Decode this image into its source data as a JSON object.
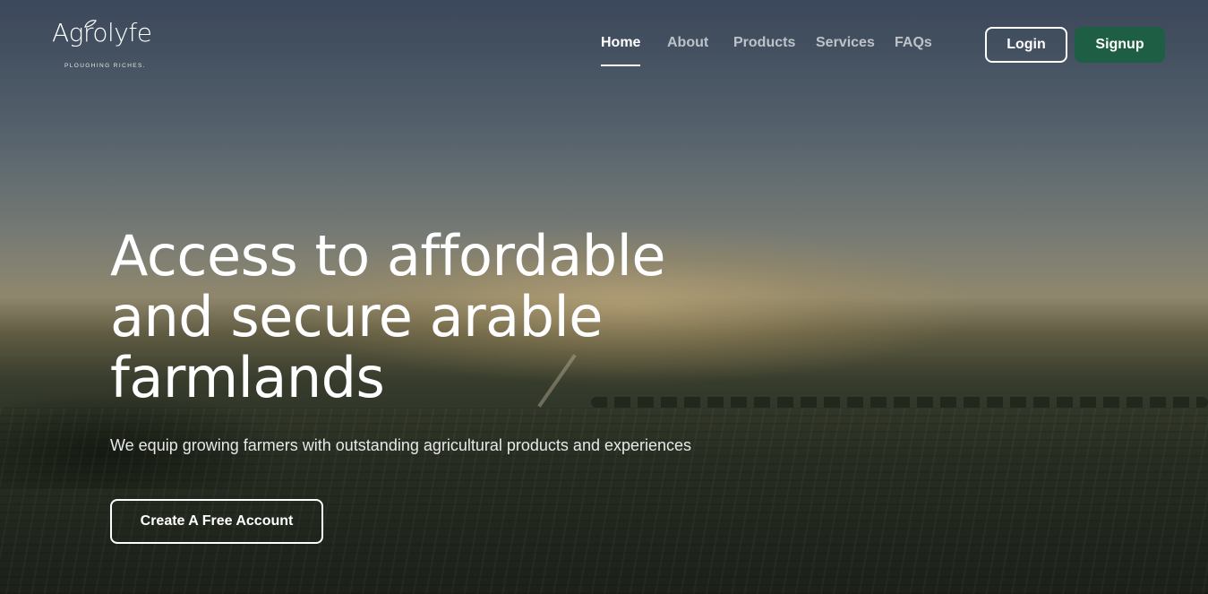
{
  "brand": {
    "logo_text": "Agrolyfe",
    "tagline": "PLOUGHING RICHES."
  },
  "nav": {
    "items": [
      {
        "label": "Home",
        "active": true
      },
      {
        "label": "About",
        "active": false
      },
      {
        "label": "Products",
        "active": false
      },
      {
        "label": "Services",
        "active": false
      },
      {
        "label": "FAQs",
        "active": false
      }
    ]
  },
  "auth": {
    "login_label": "Login",
    "signup_label": "Signup"
  },
  "hero": {
    "title_line1": "Access to affordable",
    "title_line2": "and secure arable",
    "title_line3": "farmlands",
    "subtitle": "We equip growing farmers with outstanding agricultural products and experiences",
    "cta_label": "Create A Free Account"
  },
  "colors": {
    "signup_bg": "#1e5e44",
    "text_primary": "#ffffff",
    "nav_inactive": "#d8dcdf"
  }
}
